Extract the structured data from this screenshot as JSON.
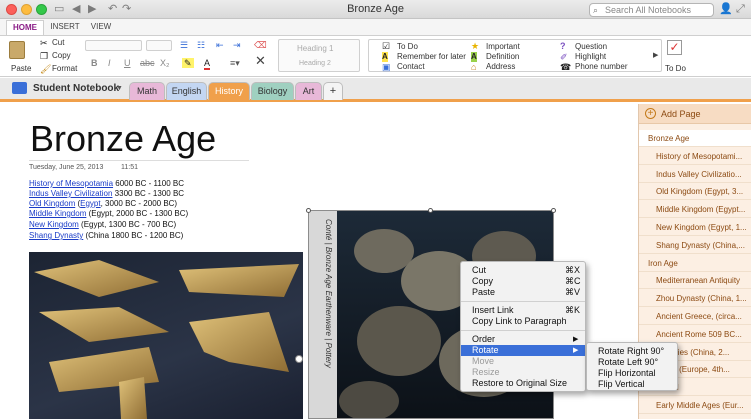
{
  "window": {
    "title": "Bronze Age",
    "search_placeholder": "Search All Notebooks"
  },
  "ribbon_tabs": [
    "HOME",
    "INSERT",
    "VIEW"
  ],
  "clipboard": {
    "paste": "Paste",
    "cut": "Cut",
    "copy": "Copy",
    "format": "Format"
  },
  "styles": {
    "heading1": "Heading 1",
    "heading2": "Heading 2"
  },
  "tags": {
    "col1": [
      "To Do",
      "Remember for later",
      "Contact"
    ],
    "col2": [
      "Important",
      "Definition",
      "Address"
    ],
    "col3": [
      "Question",
      "Highlight",
      "Phone number"
    ],
    "todo_button": "To Do"
  },
  "notebook": {
    "name": "Student Notebook",
    "sections": [
      "Math",
      "English",
      "History",
      "Biology",
      "Art"
    ],
    "active_section": "History",
    "section_colors": [
      "#e8b8d8",
      "#c3d6f2",
      "#f0a04b",
      "#9fd0c0",
      "#e8b8d8"
    ],
    "add_section": "+"
  },
  "page": {
    "title": "Bronze Age",
    "date": "Tuesday, June 25, 2013",
    "time": "11:51",
    "lines": [
      {
        "link": "History of Mesopotamia",
        "text": " 6000 BC - 1100 BC"
      },
      {
        "link": "Indus Valley Civilization",
        "text": " 3300 BC - 1300 BC"
      },
      {
        "link": "Old Kingdom",
        "text": " (",
        "link2": "Egypt",
        "text2": ", 3000 BC - 2000 BC)"
      },
      {
        "link": "Middle Kingdom",
        "text": " (Egypt, 2000 BC - 1300 BC)"
      },
      {
        "link": "New Kingdom",
        "text": " (Egypt, 1300 BC - 700 BC)"
      },
      {
        "link": "Shang Dynasty",
        "text": " (China 1800 BC - 1200 BC)"
      }
    ],
    "image_caption": "Conté | Bronze Age Earthenware | Pottery"
  },
  "pages_panel": {
    "add_page": "Add Page",
    "items": [
      {
        "label": "Bronze Age",
        "level": 0
      },
      {
        "label": "History of Mesopotami...",
        "level": 1
      },
      {
        "label": "Indus Valley Civilizatio...",
        "level": 1
      },
      {
        "label": "Old Kingdom (Egypt, 3...",
        "level": 1
      },
      {
        "label": "Middle Kingdom (Egypt...",
        "level": 1
      },
      {
        "label": "New Kingdom (Egypt, 1...",
        "level": 1
      },
      {
        "label": "Shang Dynasty (China,...",
        "level": 1
      },
      {
        "label": "Iron Age",
        "level": 0
      },
      {
        "label": "Mediterranean Antiquity",
        "level": 1
      },
      {
        "label": "Zhou Dynasty (China, 1...",
        "level": 1
      },
      {
        "label": "Ancient Greece, (circa...",
        "level": 1
      },
      {
        "label": "Ancient Rome 509 BC...",
        "level": 1
      },
      {
        "label": "...nasties (China, 2...",
        "level": 1
      },
      {
        "label": "...Age (Europe, 4th...",
        "level": 1
      },
      {
        "label": "...sical",
        "level": 1
      },
      {
        "label": "Early Middle Ages (Eur...",
        "level": 1
      }
    ]
  },
  "context_menu": [
    {
      "label": "Cut",
      "shortcut": "⌘X"
    },
    {
      "label": "Copy",
      "shortcut": "⌘C"
    },
    {
      "label": "Paste",
      "shortcut": "⌘V"
    },
    {
      "label": "Insert Link",
      "shortcut": "⌘K"
    },
    {
      "label": "Copy Link to Paragraph",
      "shortcut": ""
    },
    {
      "label": "Order",
      "shortcut": "▶"
    },
    {
      "label": "Rotate",
      "shortcut": "▶"
    },
    {
      "label": "Move",
      "shortcut": ""
    },
    {
      "label": "Resize",
      "shortcut": ""
    },
    {
      "label": "Restore to Original Size",
      "shortcut": ""
    }
  ],
  "submenu": [
    "Rotate Right 90°",
    "Rotate Left 90°",
    "Flip Horizontal",
    "Flip Vertical"
  ],
  "colors": {
    "accent": "#f0a04b",
    "menu_highlight": "#3a6fd8",
    "link": "#1a3cc7"
  }
}
